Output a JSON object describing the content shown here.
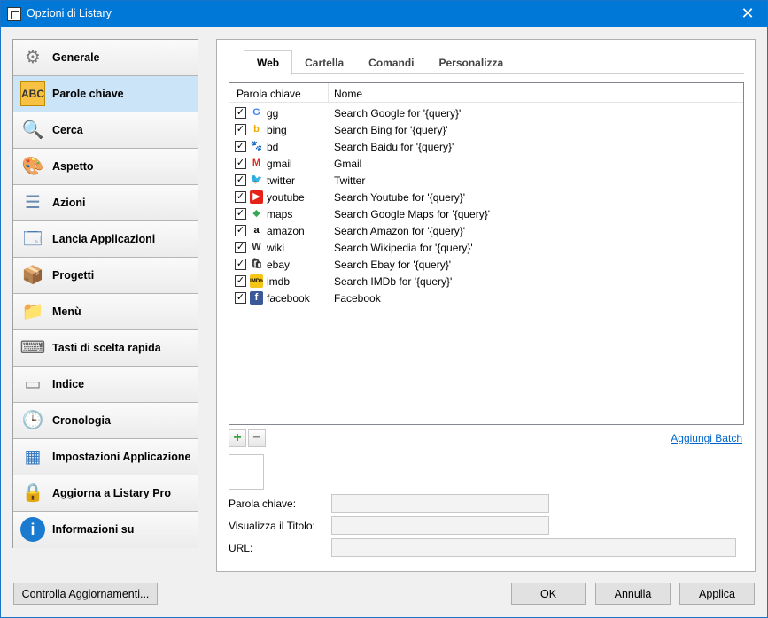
{
  "window": {
    "title": "Opzioni di Listary",
    "close_label": "✕"
  },
  "sidebar": {
    "items": [
      {
        "label": "Generale",
        "icon": "gear-icon",
        "glyph": "⚙",
        "color": "#7a7a7a"
      },
      {
        "label": "Parole chiave",
        "icon": "abc-icon",
        "glyph": "ABC",
        "color": "#d08a00"
      },
      {
        "label": "Cerca",
        "icon": "magnifier-icon",
        "glyph": "🔍",
        "color": "#c08a00"
      },
      {
        "label": "Aspetto",
        "icon": "palette-icon",
        "glyph": "🎨",
        "color": "#888"
      },
      {
        "label": "Azioni",
        "icon": "actions-icon",
        "glyph": "☰",
        "color": "#6a8ab0"
      },
      {
        "label": "Lancia Applicazioni",
        "icon": "windows-icon",
        "glyph": "🗔",
        "color": "#4a7ab0"
      },
      {
        "label": "Progetti",
        "icon": "boxes-icon",
        "glyph": "📦",
        "color": "#c08040"
      },
      {
        "label": "Menù",
        "icon": "folder-heart-icon",
        "glyph": "📁",
        "color": "#e0a040"
      },
      {
        "label": "Tasti di scelta rapida",
        "icon": "keyboard-icon",
        "glyph": "⌨",
        "color": "#666"
      },
      {
        "label": "Indice",
        "icon": "drive-icon",
        "glyph": "▭",
        "color": "#777"
      },
      {
        "label": "Cronologia",
        "icon": "clock-icon",
        "glyph": "🕒",
        "color": "#4a9a4a"
      },
      {
        "label": "Impostazioni Applicazione",
        "icon": "app-settings-icon",
        "glyph": "▦",
        "color": "#3a7ac0"
      },
      {
        "label": "Aggiorna a Listary Pro",
        "icon": "lock-icon",
        "glyph": "🔒",
        "color": "#c09000"
      },
      {
        "label": "Informazioni su",
        "icon": "info-icon",
        "glyph": "i",
        "color": "#1a7ad0"
      }
    ],
    "active_index": 1
  },
  "tabs": [
    {
      "label": "Web",
      "active": true
    },
    {
      "label": "Cartella",
      "active": false
    },
    {
      "label": "Comandi",
      "active": false
    },
    {
      "label": "Personalizza",
      "active": false
    }
  ],
  "list": {
    "columns": [
      "Parola chiave",
      "Nome"
    ],
    "rows": [
      {
        "keyword": "gg",
        "name": "Search Google for '{query}'",
        "icon": "google-icon",
        "glyph": "G",
        "fg": "#4285f4",
        "bg": "#ffffff",
        "checked": true
      },
      {
        "keyword": "bing",
        "name": "Search Bing for '{query}'",
        "icon": "bing-icon",
        "glyph": "b",
        "fg": "#f2a900",
        "bg": "#ffffff",
        "checked": true
      },
      {
        "keyword": "bd",
        "name": "Search Baidu for '{query}'",
        "icon": "baidu-icon",
        "glyph": "🐾",
        "fg": "#2932e1",
        "bg": "#ffffff",
        "checked": true
      },
      {
        "keyword": "gmail",
        "name": "Gmail",
        "icon": "gmail-icon",
        "glyph": "M",
        "fg": "#d93025",
        "bg": "#ffffff",
        "checked": true
      },
      {
        "keyword": "twitter",
        "name": "Twitter",
        "icon": "twitter-icon",
        "glyph": "🐦",
        "fg": "#1da1f2",
        "bg": "#ffffff",
        "checked": true
      },
      {
        "keyword": "youtube",
        "name": "Search Youtube for '{query}'",
        "icon": "youtube-icon",
        "glyph": "▶",
        "fg": "#ffffff",
        "bg": "#e62117",
        "checked": true
      },
      {
        "keyword": "maps",
        "name": "Search Google Maps for '{query}'",
        "icon": "maps-icon",
        "glyph": "⬥",
        "fg": "#34a853",
        "bg": "#ffffff",
        "checked": true
      },
      {
        "keyword": "amazon",
        "name": "Search Amazon for '{query}'",
        "icon": "amazon-icon",
        "glyph": "a",
        "fg": "#000000",
        "bg": "#ffffff",
        "checked": true
      },
      {
        "keyword": "wiki",
        "name": "Search Wikipedia for '{query}'",
        "icon": "wikipedia-icon",
        "glyph": "W",
        "fg": "#333333",
        "bg": "#ffffff",
        "checked": true
      },
      {
        "keyword": "ebay",
        "name": "Search Ebay for '{query}'",
        "icon": "ebay-icon",
        "glyph": "🛍",
        "fg": "#333333",
        "bg": "#ffffff",
        "checked": true
      },
      {
        "keyword": "imdb",
        "name": "Search IMDb for '{query}'",
        "icon": "imdb-icon",
        "glyph": "IMDb",
        "fg": "#000000",
        "bg": "#f5c518",
        "checked": true
      },
      {
        "keyword": "facebook",
        "name": "Facebook",
        "icon": "facebook-icon",
        "glyph": "f",
        "fg": "#ffffff",
        "bg": "#3b5998",
        "checked": true
      }
    ]
  },
  "list_actions": {
    "add_glyph": "+",
    "remove_glyph": "−",
    "batch_label": "Aggiungi Batch"
  },
  "form": {
    "keyword_label": "Parola chiave:",
    "keyword_value": "",
    "title_label": "Visualizza il Titolo:",
    "title_value": "",
    "url_label": "URL:",
    "url_value": ""
  },
  "footer": {
    "check_updates_label": "Controlla Aggiornamenti...",
    "ok_label": "OK",
    "cancel_label": "Annulla",
    "apply_label": "Applica"
  },
  "colors": {
    "titlebar": "#0078d7",
    "active_item": "#cce4f7",
    "link": "#0066cc"
  }
}
